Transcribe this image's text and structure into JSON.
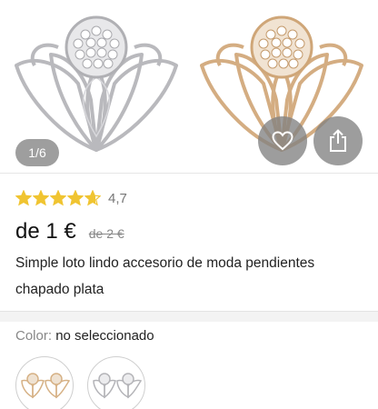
{
  "gallery": {
    "page_indicator": "1/6",
    "images": [
      "silver-earring",
      "gold-earring"
    ]
  },
  "actions": {
    "favorite_icon": "heart-icon",
    "share_icon": "share-icon"
  },
  "product": {
    "rating_value": 4.7,
    "rating_text": "4,7",
    "price": "de 1 €",
    "old_price": "de 2 €",
    "title": "Simple loto lindo accesorio de moda pendientes chapado plata"
  },
  "color_option": {
    "label": "Color:",
    "value": "no seleccionado",
    "swatches": [
      "gold",
      "silver"
    ]
  },
  "colors": {
    "star": "#f0c431",
    "silver": "#c9c9cc",
    "gold": "#d9b38a",
    "overlay": "#828282"
  }
}
